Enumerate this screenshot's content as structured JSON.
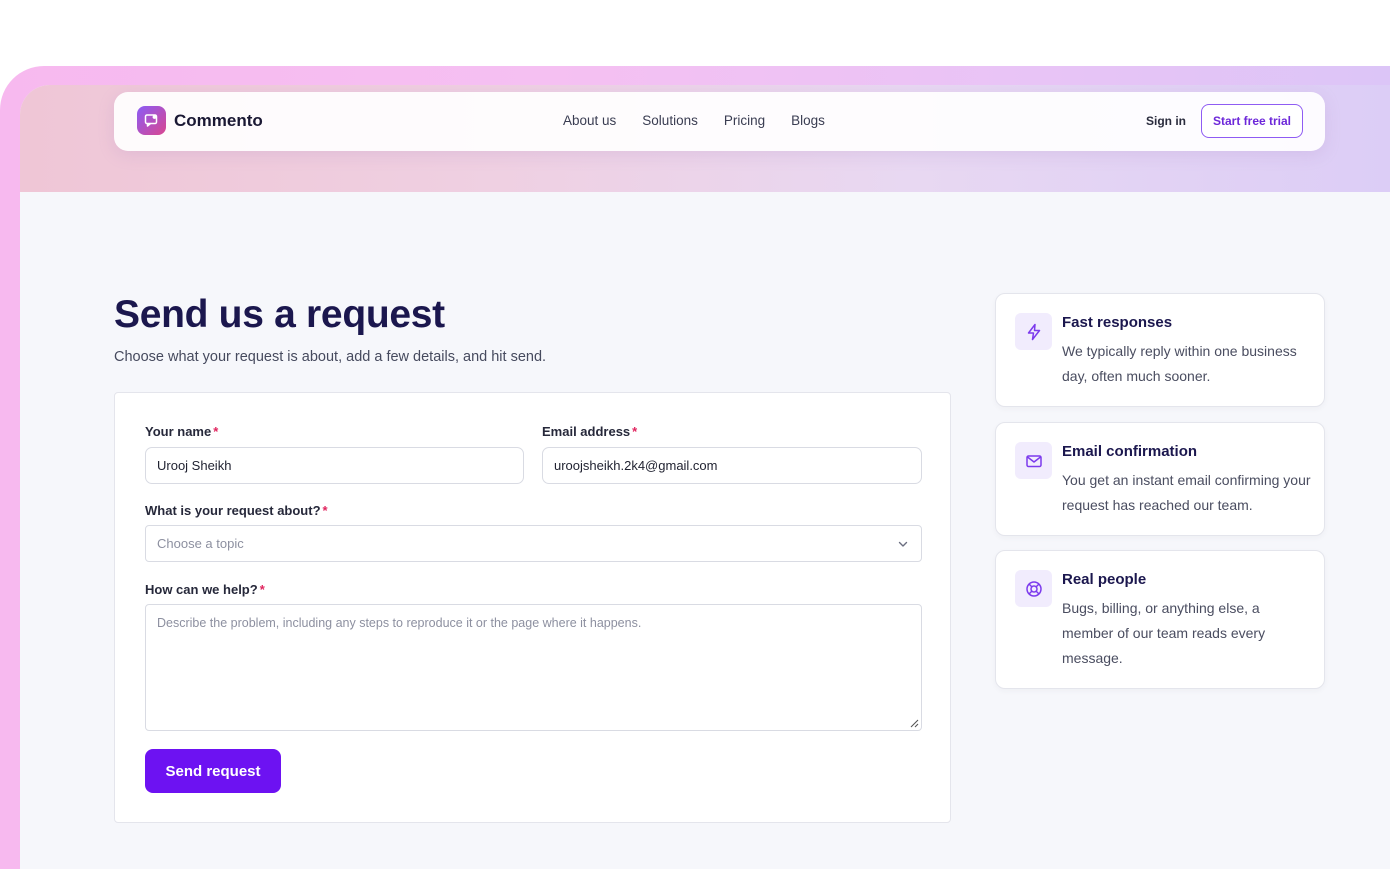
{
  "brand": {
    "name": "Commento",
    "accent": "#6d12f2"
  },
  "nav": {
    "links": [
      "About us",
      "Solutions",
      "Pricing",
      "Blogs"
    ],
    "sign_in": "Sign in",
    "cta": "Start free trial"
  },
  "page": {
    "title": "Send us a request",
    "subtitle": "Choose what your request is about, add a few details, and hit send."
  },
  "form": {
    "name": {
      "label": "Your name",
      "required_mark": "*",
      "value": "Urooj Sheikh"
    },
    "email": {
      "label": "Email address",
      "required_mark": "*",
      "value": "uroojsheikh.2k4@gmail.com"
    },
    "topic": {
      "label": "What is your request about?",
      "required_mark": "*",
      "placeholder": "Choose a topic"
    },
    "help": {
      "label": "How can we help?",
      "required_mark": "*",
      "placeholder": "Describe the problem, including any steps to reproduce it or the page where it happens."
    },
    "submit": "Send request"
  },
  "info_cards": [
    {
      "icon": "lightning-icon",
      "title": "Fast responses",
      "text": "We typically reply within one business day, often much sooner."
    },
    {
      "icon": "envelope-icon",
      "title": "Email confirmation",
      "text": "You get an instant email confirming your request has reached our team."
    },
    {
      "icon": "lifebuoy-icon",
      "title": "Real people",
      "text": "Bugs, billing, or anything else, a member of our team reads every message."
    }
  ]
}
